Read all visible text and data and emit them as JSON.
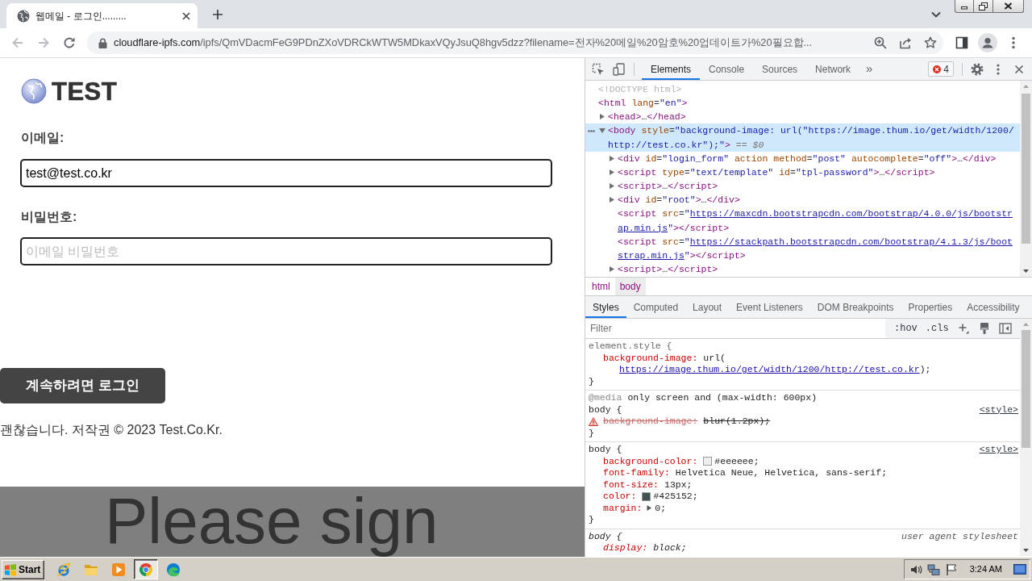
{
  "browser": {
    "tabs": [
      {
        "title": "웹메일 - 로그인.........",
        "selected": true
      }
    ],
    "nav_buttons": [
      {
        "kind": "back",
        "disabled": true
      },
      {
        "kind": "forward",
        "disabled": true
      },
      {
        "kind": "reload",
        "disabled": false
      }
    ],
    "address": {
      "host": "cloudflare-ipfs.com",
      "path": "/ipfs/QmVDacmFeG9PDnZXoVDRCkWTW5MDkaxVQyJsuQ8hgv5dzz?filename=전자%20메일%20암호%20업데이트가%20필요합..."
    }
  },
  "page": {
    "logo": "TEST",
    "fields": [
      {
        "label": "이메일:",
        "value": "test@test.co.kr"
      },
      {
        "label": "비밀번호:",
        "placeholder": "이메일 비밀번호"
      }
    ],
    "submit": "계속하려면 로그인",
    "footer": "괜찮습니다. 저작권 © 2023 Test.Co.Kr.",
    "backdrop": {
      "heading": "Please sign"
    }
  },
  "devtools": {
    "tabs": [
      {
        "label": "Elements",
        "selected": true
      },
      {
        "label": "Console",
        "selected": false
      },
      {
        "label": "Sources",
        "selected": false
      },
      {
        "label": "Network",
        "selected": false
      }
    ],
    "overflow": "»",
    "error_count": "4",
    "dom_tree": [
      {
        "lines": [
          [
            {
              "kind": "doctype",
              "text": "<!DOCTYPE html>"
            }
          ]
        ],
        "selected": false
      },
      {
        "lines": [
          [
            {
              "kind": "tag",
              "text": "<html"
            },
            {
              "kind": "attr",
              "text": " lang"
            },
            {
              "kind": "text",
              "text": "="
            },
            {
              "kind": "value",
              "text": "\"en\""
            },
            {
              "kind": "tag",
              "text": ">"
            }
          ]
        ],
        "selected": false,
        "children": [
          {
            "lines": [
              [
                {
                  "kind": "tag",
                  "text": "<head>"
                },
                {
                  "kind": "text",
                  "text": "…"
                },
                {
                  "kind": "tag",
                  "text": "</head>"
                }
              ]
            ],
            "expanded": false,
            "selected": false
          },
          {
            "lines": [
              [
                {
                  "kind": "tag",
                  "text": "<body"
                },
                {
                  "kind": "attr",
                  "text": " style"
                },
                {
                  "kind": "text",
                  "text": "="
                },
                {
                  "kind": "value",
                  "text": "\"background-image: url(\"https://image.thum.io/get/width/1200/"
                }
              ],
              [
                {
                  "kind": "value",
                  "text": "http://test.co.kr\");\""
                },
                {
                  "kind": "tag",
                  "text": ">"
                },
                {
                  "kind": "hint",
                  "text": "== $0"
                }
              ]
            ],
            "expanded": true,
            "selected": true,
            "children": [
              {
                "lines": [
                  [
                    {
                      "kind": "tag",
                      "text": "<div"
                    },
                    {
                      "kind": "attr",
                      "text": " id"
                    },
                    {
                      "kind": "text",
                      "text": "="
                    },
                    {
                      "kind": "value",
                      "text": "\"login_form\""
                    },
                    {
                      "kind": "attr",
                      "text": " action"
                    },
                    {
                      "kind": "attr",
                      "text": " method"
                    },
                    {
                      "kind": "text",
                      "text": "="
                    },
                    {
                      "kind": "value",
                      "text": "\"post\""
                    },
                    {
                      "kind": "attr",
                      "text": " autocomplete"
                    },
                    {
                      "kind": "text",
                      "text": "="
                    },
                    {
                      "kind": "value",
                      "text": "\"off\""
                    },
                    {
                      "kind": "tag",
                      "text": ">"
                    },
                    {
                      "kind": "text",
                      "text": "…"
                    },
                    {
                      "kind": "tag",
                      "text": "</div>"
                    }
                  ]
                ],
                "expanded": false,
                "selected": false
              },
              {
                "lines": [
                  [
                    {
                      "kind": "tag",
                      "text": "<script"
                    },
                    {
                      "kind": "attr",
                      "text": " type"
                    },
                    {
                      "kind": "text",
                      "text": "="
                    },
                    {
                      "kind": "value",
                      "text": "\"text/template\""
                    },
                    {
                      "kind": "attr",
                      "text": " id"
                    },
                    {
                      "kind": "text",
                      "text": "="
                    },
                    {
                      "kind": "value",
                      "text": "\"tpl-password\""
                    },
                    {
                      "kind": "tag",
                      "text": ">"
                    },
                    {
                      "kind": "text",
                      "text": "…"
                    },
                    {
                      "kind": "tag",
                      "text": "</script>"
                    }
                  ]
                ],
                "expanded": false,
                "selected": false
              },
              {
                "lines": [
                  [
                    {
                      "kind": "tag",
                      "text": "<script>"
                    },
                    {
                      "kind": "text",
                      "text": "…"
                    },
                    {
                      "kind": "tag",
                      "text": "</script>"
                    }
                  ]
                ],
                "expanded": false,
                "selected": false
              },
              {
                "lines": [
                  [
                    {
                      "kind": "tag",
                      "text": "<div"
                    },
                    {
                      "kind": "attr",
                      "text": " id"
                    },
                    {
                      "kind": "text",
                      "text": "="
                    },
                    {
                      "kind": "value",
                      "text": "\"root\""
                    },
                    {
                      "kind": "tag",
                      "text": ">"
                    },
                    {
                      "kind": "text",
                      "text": "…"
                    },
                    {
                      "kind": "tag",
                      "text": "</div>"
                    }
                  ]
                ],
                "expanded": false,
                "selected": false
              },
              {
                "lines": [
                  [
                    {
                      "kind": "tag",
                      "text": "<script"
                    },
                    {
                      "kind": "attr",
                      "text": " src"
                    },
                    {
                      "kind": "text",
                      "text": "="
                    },
                    {
                      "kind": "value",
                      "text": "\""
                    },
                    {
                      "kind": "link",
                      "text": "https://maxcdn.bootstrapcdn.com/bootstrap/4.0.0/js/bootstr"
                    }
                  ],
                  [
                    {
                      "kind": "link",
                      "text": "ap.min.js"
                    },
                    {
                      "kind": "value",
                      "text": "\""
                    },
                    {
                      "kind": "tag",
                      "text": "></script>"
                    }
                  ]
                ],
                "selected": false
              },
              {
                "lines": [
                  [
                    {
                      "kind": "tag",
                      "text": "<script"
                    },
                    {
                      "kind": "attr",
                      "text": " src"
                    },
                    {
                      "kind": "text",
                      "text": "="
                    },
                    {
                      "kind": "value",
                      "text": "\""
                    },
                    {
                      "kind": "link",
                      "text": "https://stackpath.bootstrapcdn.com/bootstrap/4.1.3/js/boot"
                    }
                  ],
                  [
                    {
                      "kind": "link",
                      "text": "strap.min.js"
                    },
                    {
                      "kind": "value",
                      "text": "\""
                    },
                    {
                      "kind": "tag",
                      "text": "></script>"
                    }
                  ]
                ],
                "selected": false
              },
              {
                "lines": [
                  [
                    {
                      "kind": "tag",
                      "text": "<script>"
                    },
                    {
                      "kind": "text",
                      "text": "…"
                    },
                    {
                      "kind": "tag",
                      "text": "</script>"
                    }
                  ]
                ],
                "expanded": false,
                "selected": false
              }
            ]
          }
        ]
      }
    ],
    "breadcrumbs": [
      {
        "label": "html",
        "selected": false
      },
      {
        "label": "body",
        "selected": true
      }
    ],
    "pane_tabs": [
      {
        "label": "Styles",
        "selected": true
      },
      {
        "label": "Computed",
        "selected": false
      },
      {
        "label": "Layout",
        "selected": false
      },
      {
        "label": "Event Listeners",
        "selected": false
      },
      {
        "label": "DOM Breakpoints",
        "selected": false
      },
      {
        "label": "Properties",
        "selected": false
      },
      {
        "label": "Accessibility",
        "selected": false
      }
    ],
    "filter": {
      "placeholder": "Filter",
      "toggles": [
        ":hov",
        ".cls"
      ]
    },
    "rules": [
      {
        "kind": "inline",
        "selector": "element.style {",
        "declarations": [
          {
            "property": "background-image:",
            "value": "url(",
            "continuation": [
              {
                "kind": "link",
                "text": "https://image.thum.io/get/width/1200/http://test.co.kr"
              },
              {
                "kind": "text",
                "text": ");"
              }
            ],
            "overridden": false,
            "warning": false
          }
        ],
        "close": "}"
      },
      {
        "kind": "author",
        "media": {
          "keyword": "@media",
          "query": "only screen and (max-width: 600px)"
        },
        "selector": "body {",
        "source": "<style>",
        "declarations": [
          {
            "property": "background-image:",
            "value": "blur(1.2px);",
            "overridden": true,
            "warning": true
          }
        ],
        "close": "}"
      },
      {
        "kind": "author",
        "selector": "body {",
        "source": "<style>",
        "declarations": [
          {
            "property": "background-color:",
            "value": "#eeeeee;",
            "color": "#eeeeee",
            "overridden": false,
            "warning": false
          },
          {
            "property": "font-family:",
            "value": "Helvetica Neue, Helvetica, sans-serif;",
            "overridden": false,
            "warning": false
          },
          {
            "property": "font-size:",
            "value": "13px;",
            "overridden": false,
            "warning": false
          },
          {
            "property": "color:",
            "value": "#425152;",
            "color": "#425152",
            "overridden": false,
            "warning": false
          },
          {
            "property": "margin:",
            "value": "0;",
            "expanded": false,
            "overridden": false,
            "warning": false
          }
        ],
        "close": "}"
      },
      {
        "kind": "user-agent",
        "selector": "body {",
        "source": "user agent stylesheet",
        "declarations": [
          {
            "property": "display:",
            "value": "block;",
            "overridden": false,
            "warning": false
          }
        ]
      }
    ]
  },
  "taskbar": {
    "start": "Start",
    "apps": [
      {
        "kind": "ie",
        "selected": false
      },
      {
        "kind": "explorer",
        "selected": false
      },
      {
        "kind": "player",
        "selected": false
      },
      {
        "kind": "chrome",
        "selected": true
      },
      {
        "kind": "edge",
        "selected": false
      }
    ],
    "clock": "3:24 AM"
  }
}
